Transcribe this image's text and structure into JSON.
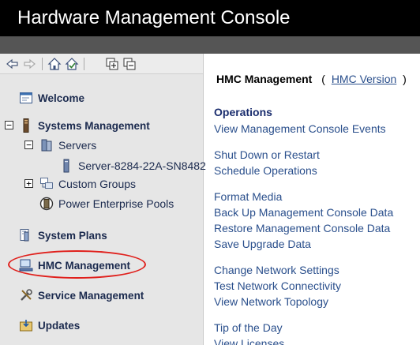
{
  "title": "Hardware Management Console",
  "toolbar": {
    "back_icon": "back-arrow-icon",
    "forward_icon": "forward-arrow-icon",
    "home_icon": "home-icon",
    "home_check_icon": "home-check-icon",
    "expand_icon": "expand-all-icon",
    "collapse_icon": "collapse-all-icon"
  },
  "nav": {
    "welcome": "Welcome",
    "systems_management": "Systems Management",
    "servers": "Servers",
    "server": "Server-8284-22A-SN8482",
    "custom_groups": "Custom Groups",
    "power_pools": "Power Enterprise Pools",
    "system_plans": "System Plans",
    "hmc_management": "HMC Management",
    "service_management": "Service Management",
    "updates": "Updates"
  },
  "main": {
    "heading": "HMC Management",
    "open_paren": "(",
    "version_link": "HMC Version",
    "close_paren": ")",
    "section": "Operations",
    "tasks": [
      "View Management Console Events",
      "Shut Down or Restart",
      "Schedule Operations",
      "Format Media",
      "Back Up Management Console Data",
      "Restore Management Console Data",
      "Save Upgrade Data",
      "Change Network Settings",
      "Test Network Connectivity",
      "View Network Topology",
      "Tip of the Day",
      "View Licenses"
    ]
  },
  "colors": {
    "title_bg": "#000000",
    "nav_bg": "#e6e6e6",
    "link": "#2a4f8c",
    "section": "#1a2d6e",
    "highlight_circle": "#e0201c"
  }
}
